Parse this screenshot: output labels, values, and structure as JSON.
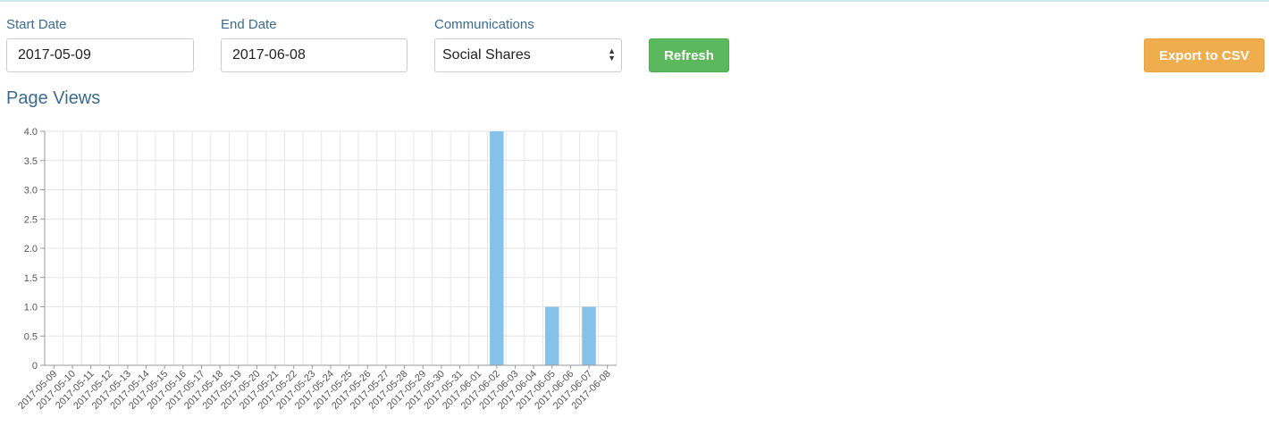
{
  "filters": {
    "start_date_label": "Start Date",
    "start_date_value": "2017-05-09",
    "end_date_label": "End Date",
    "end_date_value": "2017-06-08",
    "communications_label": "Communications",
    "communications_value": "Social Shares"
  },
  "actions": {
    "refresh_label": "Refresh",
    "export_label": "Export to CSV"
  },
  "section_title": "Page Views",
  "colors": {
    "bar": "#85c1e9",
    "refresh": "#5cb85c",
    "export": "#f0ad4e",
    "label": "#3b6b8f"
  },
  "chart_data": {
    "type": "bar",
    "title": "",
    "xlabel": "",
    "ylabel": "",
    "ylim": [
      0,
      4.0
    ],
    "yticks": [
      "0",
      "0.5",
      "1.0",
      "1.5",
      "2.0",
      "2.5",
      "3.0",
      "3.5",
      "4.0"
    ],
    "grid": true,
    "categories": [
      "2017-05-09",
      "2017-05-10",
      "2017-05-11",
      "2017-05-12",
      "2017-05-13",
      "2017-05-14",
      "2017-05-15",
      "2017-05-16",
      "2017-05-17",
      "2017-05-18",
      "2017-05-19",
      "2017-05-20",
      "2017-05-21",
      "2017-05-22",
      "2017-05-23",
      "2017-05-24",
      "2017-05-25",
      "2017-05-26",
      "2017-05-27",
      "2017-05-28",
      "2017-05-29",
      "2017-05-30",
      "2017-05-31",
      "2017-06-01",
      "2017-06-02",
      "2017-06-03",
      "2017-06-04",
      "2017-06-05",
      "2017-06-06",
      "2017-06-07",
      "2017-06-08"
    ],
    "values": [
      0,
      0,
      0,
      0,
      0,
      0,
      0,
      0,
      0,
      0,
      0,
      0,
      0,
      0,
      0,
      0,
      0,
      0,
      0,
      0,
      0,
      0,
      0,
      0,
      4,
      0,
      0,
      1,
      0,
      1,
      0
    ]
  }
}
